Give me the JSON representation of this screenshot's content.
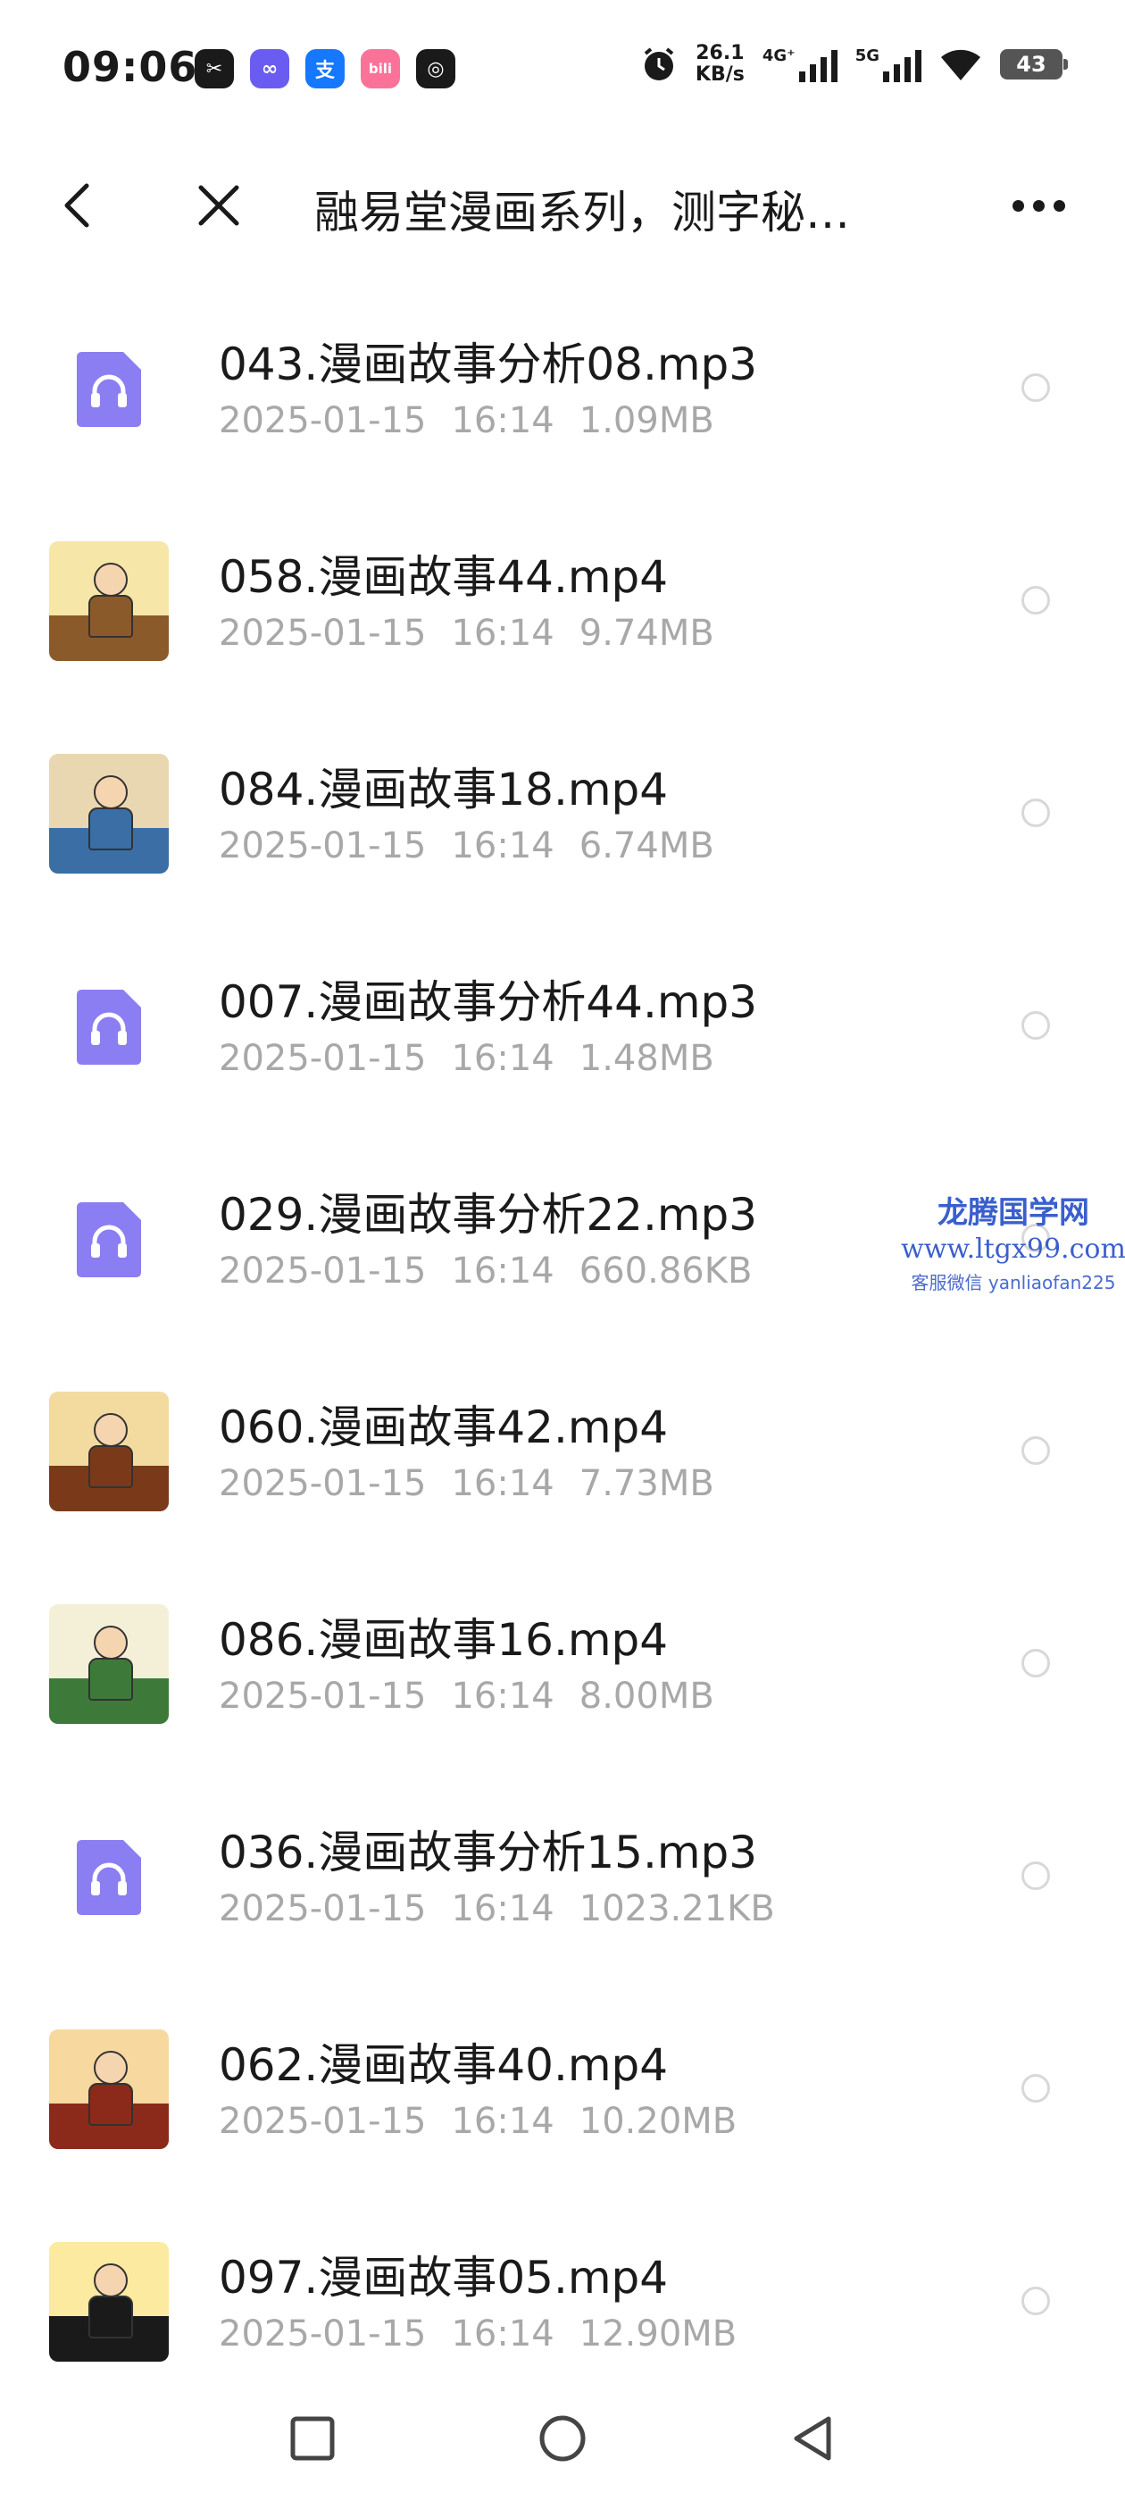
{
  "status_bar": {
    "time": "09:06",
    "app_icons": [
      {
        "name": "scissors-app-icon",
        "glyph": "✂",
        "color": "#1a1a1a"
      },
      {
        "name": "infinity-app-icon",
        "glyph": "∞",
        "color": "#6a5cf0"
      },
      {
        "name": "alipay-app-icon",
        "glyph": "支",
        "color": "#1677ff"
      },
      {
        "name": "bilibili-app-icon",
        "glyph": "bili",
        "color": "#fb7299"
      },
      {
        "name": "planet-app-icon",
        "glyph": "◎",
        "color": "#1a1a1a"
      }
    ],
    "speed_value": "26.1",
    "speed_unit": "KB/s",
    "net1_label": "4G⁺",
    "net2_label": "5G",
    "battery": "43"
  },
  "header": {
    "title": "融易堂漫画系列，测字秘…"
  },
  "files": [
    {
      "name": "043.漫画故事分析08.mp3",
      "date": "2025-01-15",
      "time": "16:14",
      "size": "1.09MB",
      "kind": "audio"
    },
    {
      "name": "058.漫画故事44.mp4",
      "date": "2025-01-15",
      "time": "16:14",
      "size": "9.74MB",
      "kind": "video",
      "colors": [
        "#f6e7a8",
        "#8a5a2b"
      ]
    },
    {
      "name": "084.漫画故事18.mp4",
      "date": "2025-01-15",
      "time": "16:14",
      "size": "6.74MB",
      "kind": "video",
      "colors": [
        "#e8d7b0",
        "#3a6ea5"
      ]
    },
    {
      "name": "007.漫画故事分析44.mp3",
      "date": "2025-01-15",
      "time": "16:14",
      "size": "1.48MB",
      "kind": "audio"
    },
    {
      "name": "029.漫画故事分析22.mp3",
      "date": "2025-01-15",
      "time": "16:14",
      "size": "660.86KB",
      "kind": "audio"
    },
    {
      "name": "060.漫画故事42.mp4",
      "date": "2025-01-15",
      "time": "16:14",
      "size": "7.73MB",
      "kind": "video",
      "colors": [
        "#f3dba0",
        "#7a3a1a"
      ]
    },
    {
      "name": "086.漫画故事16.mp4",
      "date": "2025-01-15",
      "time": "16:14",
      "size": "8.00MB",
      "kind": "video",
      "colors": [
        "#f4f0d8",
        "#3d7a3a"
      ]
    },
    {
      "name": "036.漫画故事分析15.mp3",
      "date": "2025-01-15",
      "time": "16:14",
      "size": "1023.21KB",
      "kind": "audio"
    },
    {
      "name": "062.漫画故事40.mp4",
      "date": "2025-01-15",
      "time": "16:14",
      "size": "10.20MB",
      "kind": "video",
      "colors": [
        "#f7d9a0",
        "#8b2a1a"
      ]
    },
    {
      "name": "097.漫画故事05.mp4",
      "date": "2025-01-15",
      "time": "16:14",
      "size": "12.90MB",
      "kind": "video",
      "colors": [
        "#fbeaa0",
        "#1a1a1a"
      ]
    }
  ],
  "watermark": {
    "title": "龙腾国学网",
    "url": "www.ltgx99.com",
    "contact": "客服微信 yanliaofan225"
  },
  "colors": {
    "audio_icon": "#8b7df2",
    "meta_text": "#a8a8a8",
    "radio_border": "#d8d8d8"
  }
}
